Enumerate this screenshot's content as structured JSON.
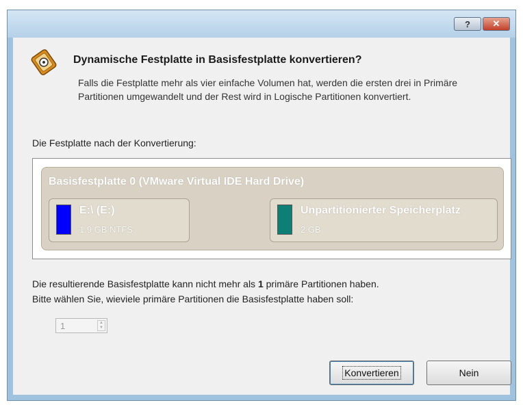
{
  "titlebar": {
    "help_label": "?",
    "close_label": "✕"
  },
  "header": {
    "title": "Dynamische Festplatte in Basisfestplatte konvertieren?",
    "description": "Falls die Festplatte mehr als vier einfache Volumen hat, werden die ersten drei in Primäre Partitionen umgewandelt und der Rest wird in Logische Partitionen konvertiert."
  },
  "preview": {
    "label": "Die Festplatte nach der Konvertierung:",
    "disk_title": "Basisfestplatte 0 (VMware Virtual IDE Hard Drive)",
    "partitions": [
      {
        "name": "E:\\ (E:)",
        "size": "1.9 GB NTFS",
        "color": "#0000ff"
      },
      {
        "name": "Unpartitionierter Speicherplatz",
        "size": "2 GB",
        "color": "#0e7f74"
      }
    ]
  },
  "info": {
    "line1_prefix": "Die resultierende Basisfestplatte kann nicht mehr als ",
    "line1_number": "1",
    "line1_suffix": " primäre Partitionen haben.",
    "line2": "Bitte wählen Sie, wieviele primäre Partitionen die Basisfestplatte haben soll:"
  },
  "spinner": {
    "value": "1"
  },
  "buttons": {
    "convert": "Konvertieren",
    "no": "Nein"
  }
}
